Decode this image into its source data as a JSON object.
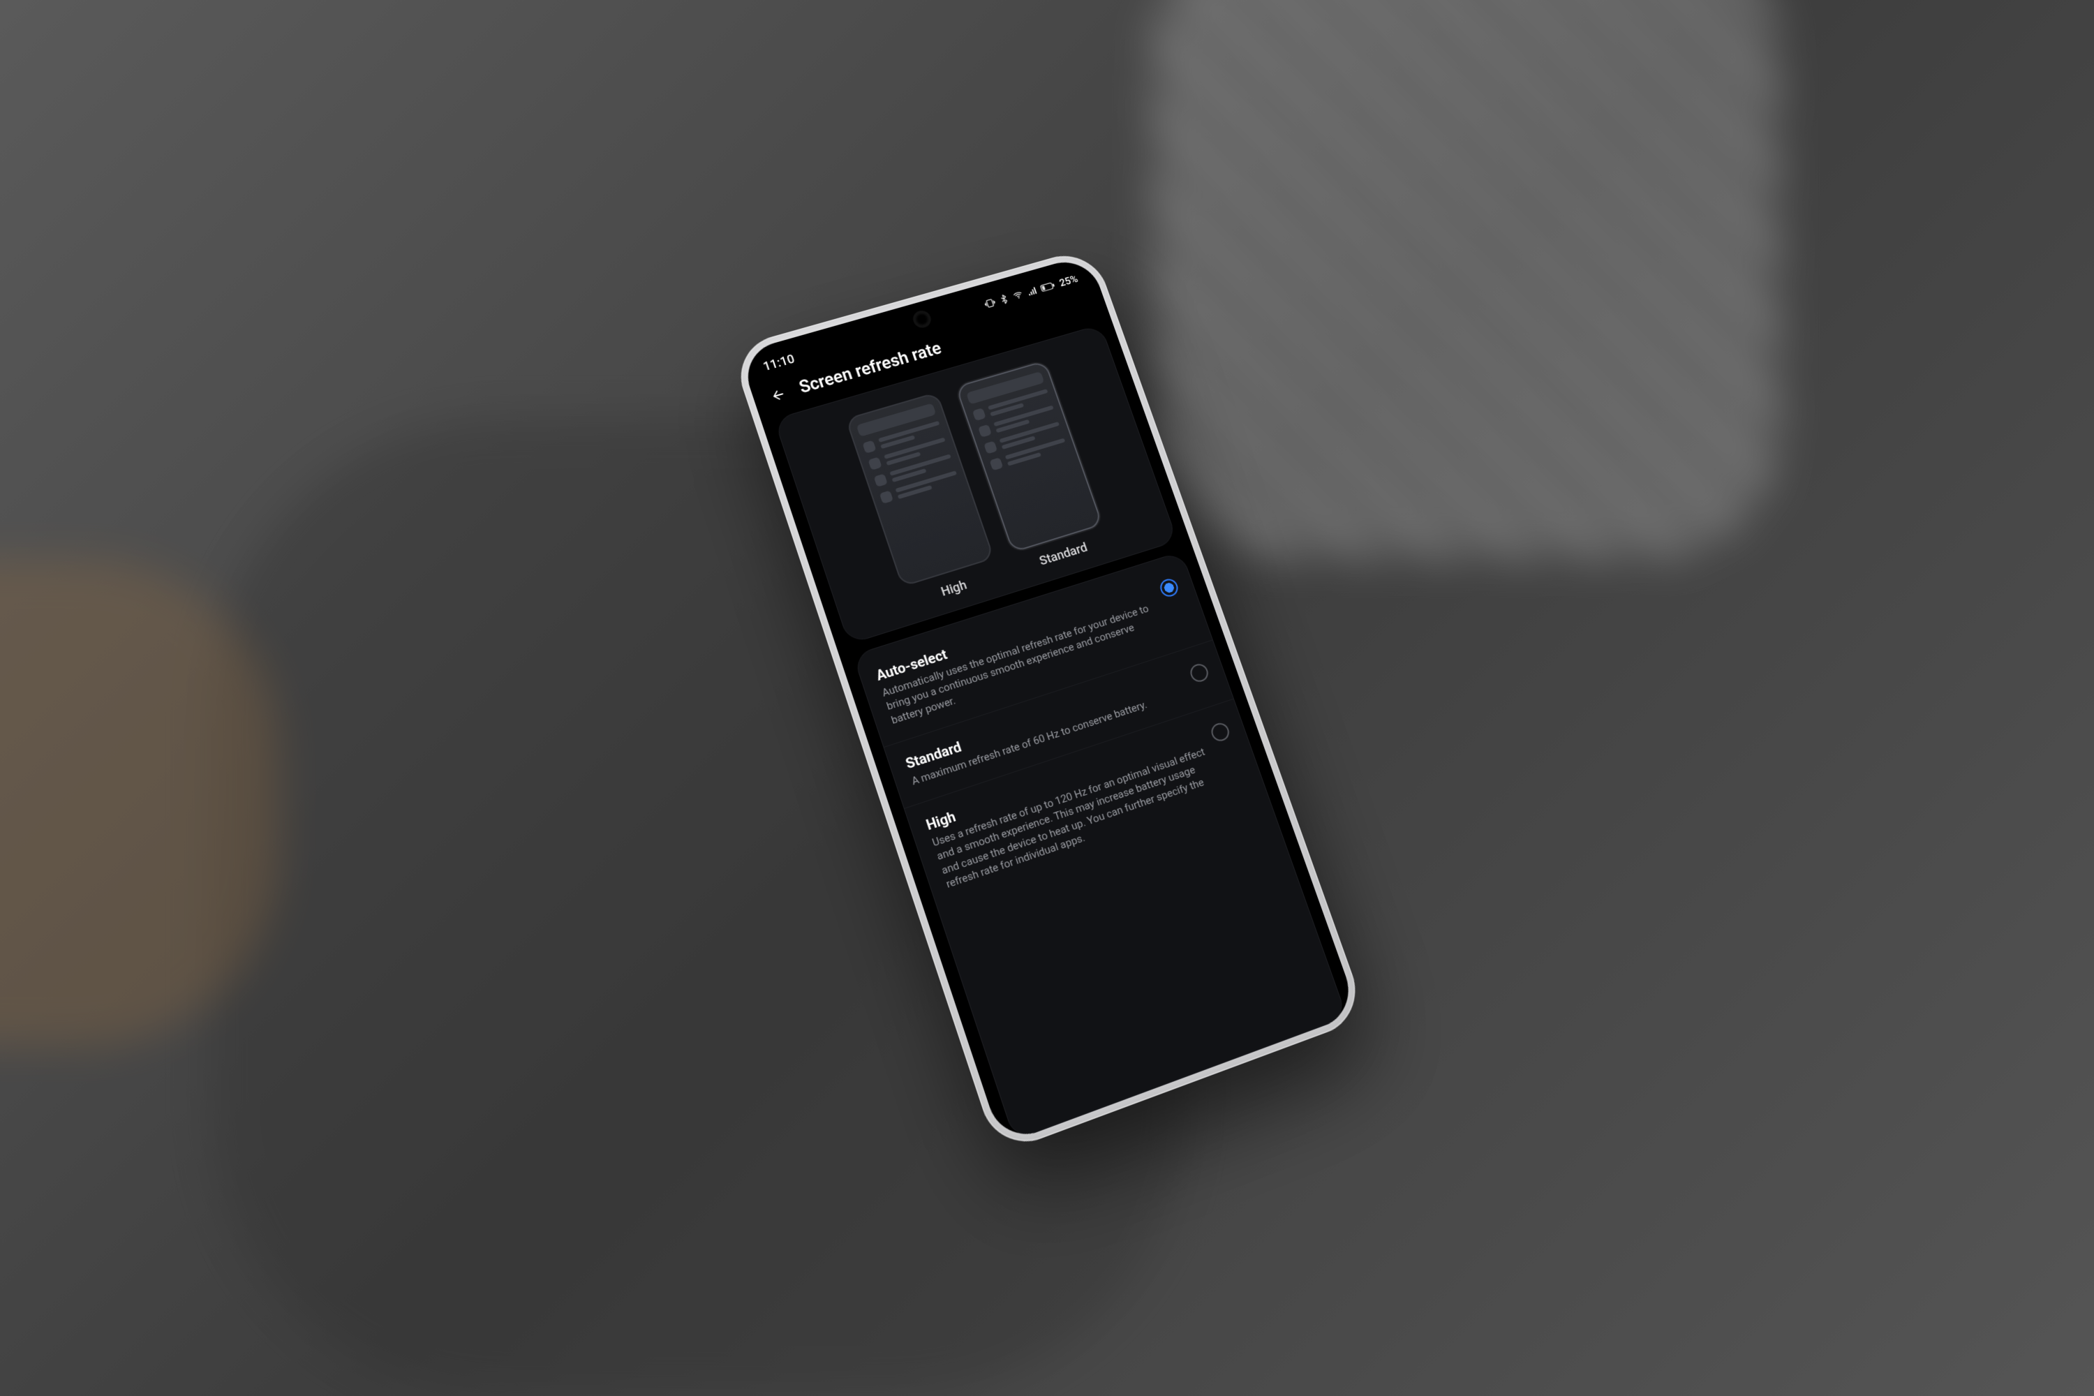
{
  "statusbar": {
    "time": "11:10",
    "battery_pct": "25%"
  },
  "header": {
    "title": "Screen refresh rate"
  },
  "preview": {
    "items": [
      {
        "label": "High"
      },
      {
        "label": "Standard"
      }
    ],
    "selected_index": 1
  },
  "options": [
    {
      "key": "auto",
      "title": "Auto-select",
      "desc": "Automatically uses the optimal refresh rate for your device to bring you a continuous smooth experience and conserve battery power.",
      "selected": true
    },
    {
      "key": "standard",
      "title": "Standard",
      "desc": "A maximum refresh rate of 60 Hz to conserve battery.",
      "selected": false
    },
    {
      "key": "high",
      "title": "High",
      "desc": "Uses a refresh rate of up to 120 Hz for an optimal visual effect and a smooth experience. This may increase battery usage and cause the device to heat up. You can further specify the refresh rate for individual apps.",
      "selected": false
    }
  ],
  "colors": {
    "accent": "#2f7dff",
    "screen_bg": "#000000",
    "card_bg": "#111215",
    "text_primary": "#ffffff",
    "text_secondary": "#9a9ca2"
  }
}
